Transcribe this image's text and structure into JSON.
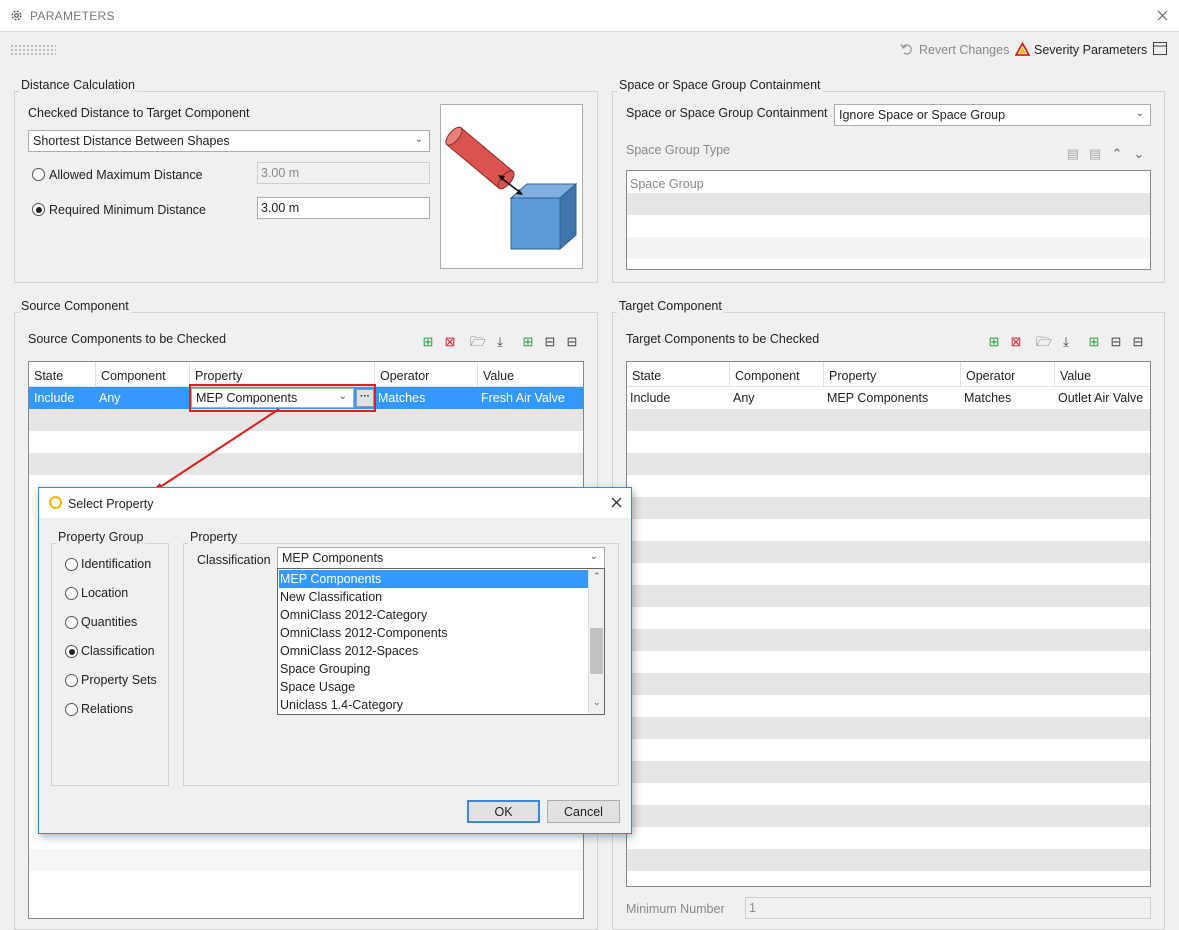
{
  "window": {
    "title": "PARAMETERS",
    "close_icon": "close-icon",
    "settings_icon": "gear-icon"
  },
  "toolbar": {
    "revert_label": "Revert Changes",
    "severity_label": "Severity Parameters"
  },
  "distance": {
    "group_title": "Distance Calculation",
    "checked_label": "Checked Distance to Target Component",
    "mode_value": "Shortest Distance Between Shapes",
    "allowed_max_label": "Allowed Maximum Distance",
    "allowed_max_value": "3.00 m",
    "required_min_label": "Required Minimum Distance",
    "required_min_value": "3.00 m",
    "selected": "required_min"
  },
  "space": {
    "group_title": "Space or Space Group Containment",
    "label": "Space or Space Group Containment",
    "value": "Ignore Space or Space Group",
    "type_label": "Space Group Type",
    "list_header": "Space Group"
  },
  "source": {
    "group_title": "Source Component",
    "subtitle": "Source Components to be Checked",
    "columns": [
      "State",
      "Component",
      "Property",
      "Operator",
      "Value"
    ],
    "rows": [
      {
        "state": "Include",
        "component": "Any",
        "property": "MEP Components",
        "operator": "Matches",
        "value": "Fresh Air Valve"
      }
    ]
  },
  "target": {
    "group_title": "Target Component",
    "subtitle": "Target Components to be Checked",
    "columns": [
      "State",
      "Component",
      "Property",
      "Operator",
      "Value"
    ],
    "rows": [
      {
        "state": "Include",
        "component": "Any",
        "property": "MEP Components",
        "operator": "Matches",
        "value": "Outlet Air Valve"
      }
    ],
    "min_number_label": "Minimum Number",
    "min_number_value": "1"
  },
  "dialog": {
    "title": "Select Property",
    "property_group_title": "Property Group",
    "groups": [
      "Identification",
      "Location",
      "Quantities",
      "Classification",
      "Property Sets",
      "Relations"
    ],
    "selected_group": "Classification",
    "property_title": "Property",
    "classification_label": "Classification",
    "classification_value": "MEP Components",
    "options": [
      "MEP Components",
      "New Classification",
      "OmniClass 2012-Category",
      "OmniClass 2012-Components",
      "OmniClass 2012-Spaces",
      "Space Grouping",
      "Space Usage",
      "Uniclass 1.4-Category"
    ],
    "ok_label": "OK",
    "cancel_label": "Cancel"
  },
  "colors": {
    "selection": "#3399ff",
    "annotation": "#e0201c",
    "accent_shape_red": "#d9534f",
    "accent_shape_blue": "#5b9bd5"
  }
}
